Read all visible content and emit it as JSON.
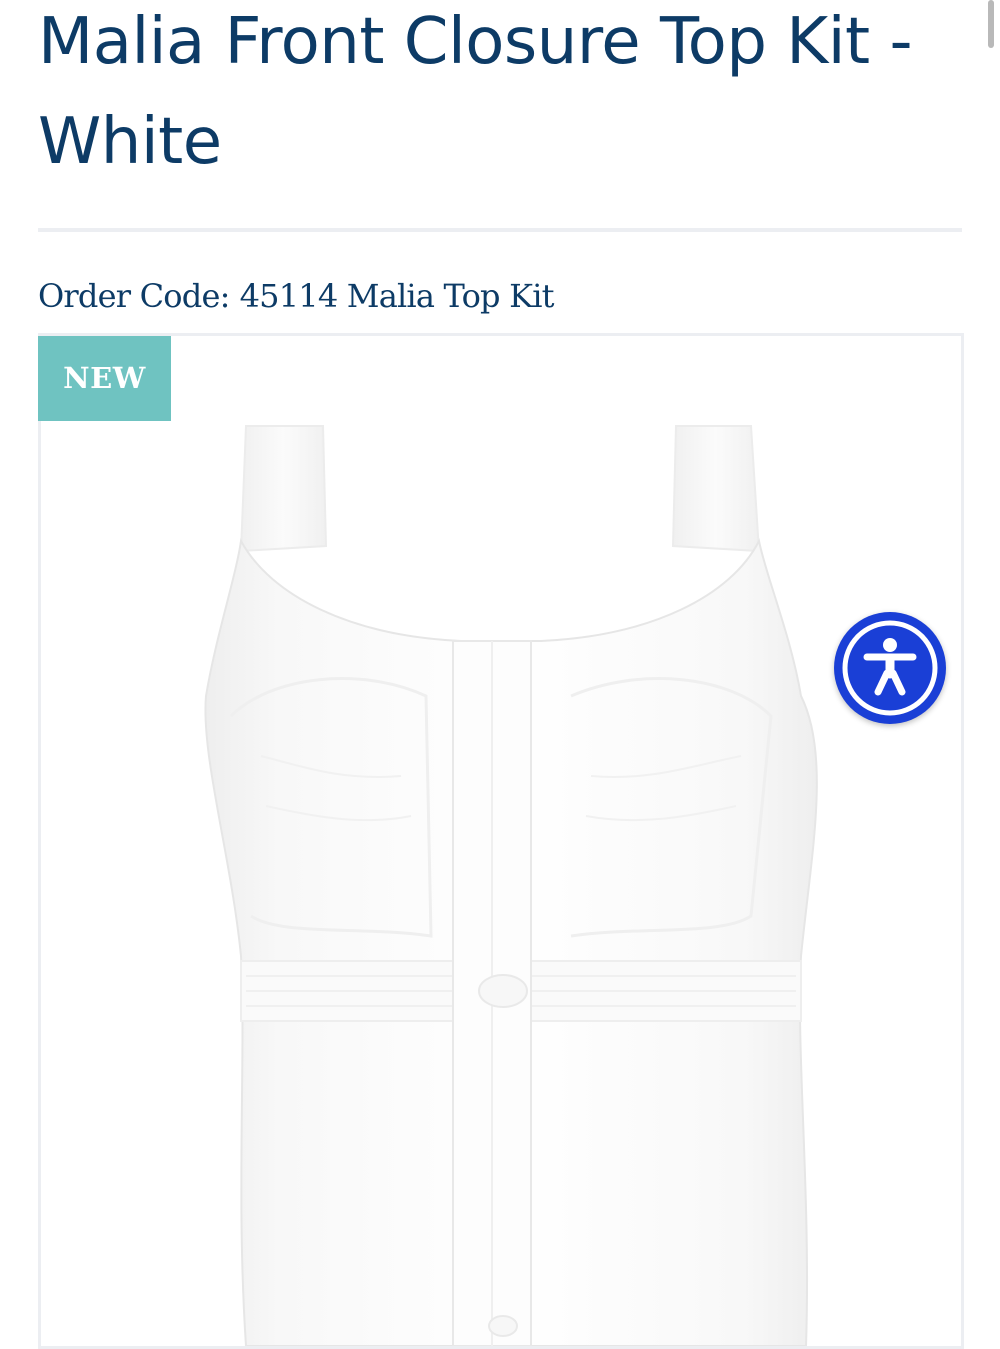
{
  "product": {
    "title": "Malia Front Closure Top Kit - White",
    "order_code_label": "Order Code:",
    "order_code_value": "45114 Malia Top Kit",
    "badge": "NEW"
  },
  "image": {
    "alt": "White front closure top with wide shoulder straps and hook-and-loop front fastening"
  },
  "accessibility_button": {
    "icon": "accessibility-person-icon"
  },
  "colors": {
    "title": "#0d3b66",
    "badge": "#6fc3c1",
    "accessibility": "#1a3fd6"
  }
}
